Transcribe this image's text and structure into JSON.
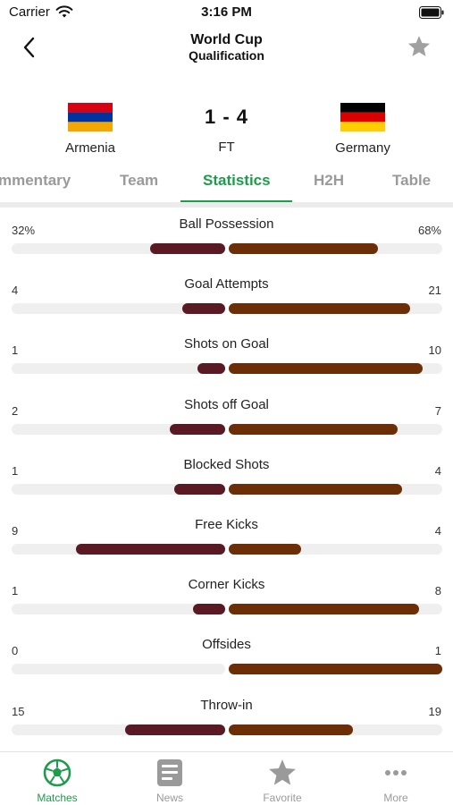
{
  "status_bar": {
    "carrier": "Carrier",
    "time": "3:16 PM"
  },
  "header": {
    "title_line1": "World Cup",
    "title_line2": "Qualification",
    "back_icon": "chevron-left-icon",
    "favorite_icon": "star-icon"
  },
  "match": {
    "home": {
      "name": "Armenia",
      "flag_colors": [
        "#d90012",
        "#0033a0",
        "#f2a800"
      ]
    },
    "away": {
      "name": "Germany",
      "flag_colors": [
        "#000000",
        "#dd0000",
        "#ffce00"
      ]
    },
    "score": "1 - 4",
    "status": "FT"
  },
  "tabs": [
    {
      "label": "mmentary",
      "active": false
    },
    {
      "label": "Team",
      "active": false
    },
    {
      "label": "Statistics",
      "active": true
    },
    {
      "label": "H2H",
      "active": false
    },
    {
      "label": "Table",
      "active": false
    }
  ],
  "colors": {
    "accent": "#1e9c4b",
    "home_bar": "#5a1a24",
    "away_bar": "#6b2e06",
    "track": "#efefef"
  },
  "stats": [
    {
      "label": "Ball Possession",
      "home": "32%",
      "away": "68%",
      "home_fraction": 0.35,
      "away_fraction": 0.7
    },
    {
      "label": "Goal Attempts",
      "home": "4",
      "away": "21",
      "home_fraction": 0.2,
      "away_fraction": 0.85
    },
    {
      "label": "Shots on Goal",
      "home": "1",
      "away": "10",
      "home_fraction": 0.13,
      "away_fraction": 0.91
    },
    {
      "label": "Shots off Goal",
      "home": "2",
      "away": "7",
      "home_fraction": 0.26,
      "away_fraction": 0.79
    },
    {
      "label": "Blocked Shots",
      "home": "1",
      "away": "4",
      "home_fraction": 0.24,
      "away_fraction": 0.81
    },
    {
      "label": "Free Kicks",
      "home": "9",
      "away": "4",
      "home_fraction": 0.7,
      "away_fraction": 0.34
    },
    {
      "label": "Corner Kicks",
      "home": "1",
      "away": "8",
      "home_fraction": 0.15,
      "away_fraction": 0.89
    },
    {
      "label": "Offsides",
      "home": "0",
      "away": "1",
      "home_fraction": 0.0,
      "away_fraction": 1.0
    },
    {
      "label": "Throw-in",
      "home": "15",
      "away": "19",
      "home_fraction": 0.47,
      "away_fraction": 0.58
    }
  ],
  "tabbar": [
    {
      "label": "Matches",
      "icon": "soccer-ball-icon",
      "active": true
    },
    {
      "label": "News",
      "icon": "news-icon",
      "active": false
    },
    {
      "label": "Favorite",
      "icon": "star-icon",
      "active": false
    },
    {
      "label": "More",
      "icon": "more-dots-icon",
      "active": false
    }
  ]
}
